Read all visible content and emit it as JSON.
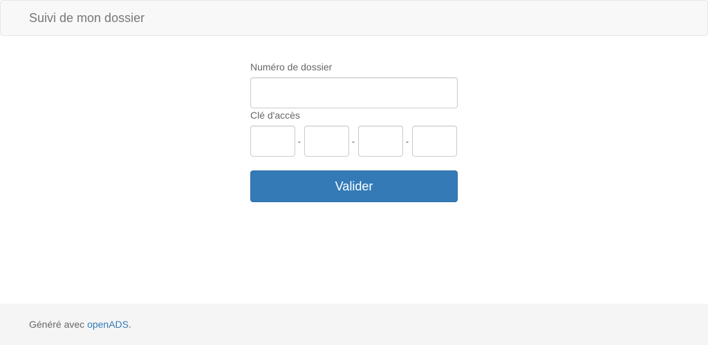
{
  "header": {
    "brand": "Suivi de mon dossier"
  },
  "form": {
    "dossier_label": "Numéro de dossier",
    "dossier_value": "",
    "cle_label": "Clé d'accès",
    "key_parts": [
      "",
      "",
      "",
      ""
    ],
    "separator": "-",
    "submit_label": "Valider"
  },
  "footer": {
    "prefix": "Généré avec ",
    "link_text": "openADS",
    "suffix": "."
  },
  "colors": {
    "primary": "#337ab7",
    "navbar_bg": "#f8f8f8",
    "footer_bg": "#f5f5f5"
  }
}
